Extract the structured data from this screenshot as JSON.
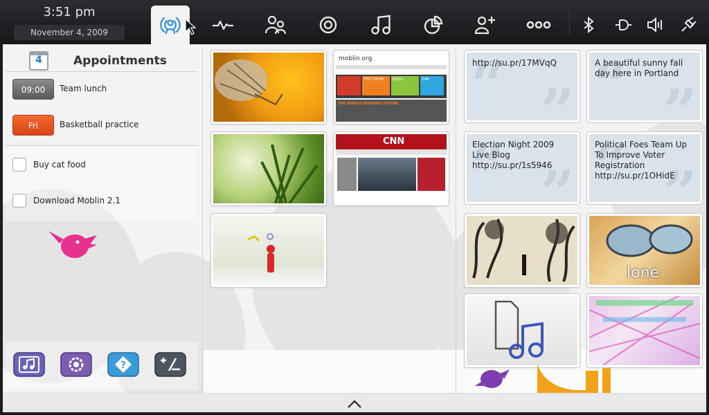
{
  "clock": {
    "time": "3:51 pm",
    "date": "November  4, 2009"
  },
  "toolbar": {
    "items": [
      "myzone-icon",
      "status-icon",
      "people-icon",
      "internet-icon",
      "media-icon",
      "pasteboard-icon",
      "applications-icon",
      "zones-icon"
    ],
    "status": [
      "bluetooth-icon",
      "network-icon",
      "volume-icon",
      "power-icon"
    ]
  },
  "appointments": {
    "title": "Appointments",
    "calendar_day": "4",
    "items": [
      {
        "badge": "09:00",
        "label": "Team lunch",
        "color": "#6e6e6e"
      },
      {
        "badge": "Fri",
        "label": "Basketball practice",
        "color": "#e5521f"
      }
    ]
  },
  "tasks": [
    {
      "label": "Buy cat food",
      "checked": false
    },
    {
      "label": "Download Moblin 2.1",
      "checked": false
    }
  ],
  "dock": [
    "applications-icon",
    "settings-icon",
    "help-icon",
    "calculator-icon"
  ],
  "web_thumbnails": {
    "moblin_site": "moblin.org",
    "moblin_headline": "THE MOBILE INTERNET FUTURE",
    "moblin_tiles": [
      "TEST DRIVE",
      "BUILD",
      "JOIN"
    ],
    "cnn_logo": "CNN"
  },
  "social": [
    {
      "text": "http://su.pr/17MVqQ"
    },
    {
      "text": "A beautiful sunny fall day here in Portland"
    },
    {
      "text": "Election Night 2009 Live Blog http://su.pr/1s5946"
    },
    {
      "text": "Political Foes Team Up To Improve Voter Registration http://su.pr/1OHidE"
    }
  ],
  "photo_captions": {
    "lone": "lone"
  },
  "bottom": {
    "expand": "chevron-up-icon"
  }
}
